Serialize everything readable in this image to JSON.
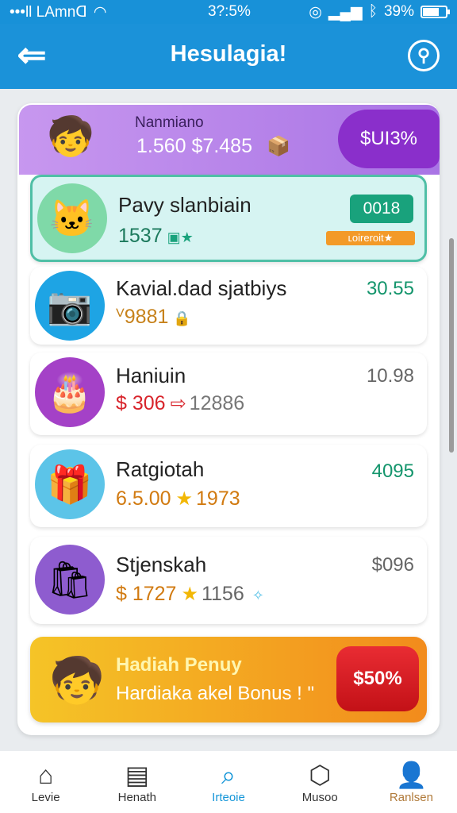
{
  "status_bar": {
    "carrier": "•••ll LAmnᗡ",
    "time": "3?:5%",
    "battery": "39%"
  },
  "header": {
    "title": "Hesulagia!",
    "back_icon": "back-arrow-icon",
    "settings_icon": "settings-icon"
  },
  "summary": {
    "name": "Nanmiano",
    "amount": "1.560 $7.485",
    "badge": "$UI3%"
  },
  "items": [
    {
      "name": "Pavy slanbiain",
      "price": "1537",
      "value": "0018",
      "badge_sub": "ʟoireroit★",
      "price_color": "#1c7a5d",
      "value_color": "#0f8f6a"
    },
    {
      "name": "Kavial.dad sjatbiys",
      "price": "ⱽ9881",
      "value": "30.55",
      "price_color": "#c7821b",
      "value_color": "#14956c"
    },
    {
      "name": "Haniuin",
      "price": "$ 306",
      "extra": "12886",
      "value": "10.98",
      "price_color": "#d8242b",
      "value_color": "#666666"
    },
    {
      "name": "Ratgiotah",
      "price": "6.5.00",
      "extra": "1973",
      "value": "4095",
      "price_color": "#d17a10",
      "value_color": "#14956c"
    },
    {
      "name": "Stjenskah",
      "price": "$ 1727",
      "extra": "1156",
      "value": "$096",
      "price_color": "#d17a10",
      "value_color": "#666666"
    }
  ],
  "bonus": {
    "title": "Hadiah Penuy",
    "subtitle": "Hardiaka akel Bonus ! \"",
    "badge": "$50%"
  },
  "nav": [
    {
      "label": "Levie",
      "icon": "home-icon"
    },
    {
      "label": "Henath",
      "icon": "gift-box-icon"
    },
    {
      "label": "Irteoie",
      "icon": "search-icon"
    },
    {
      "label": "Musoo",
      "icon": "hexagon-badge-icon"
    },
    {
      "label": "Ranlsen",
      "icon": "profile-icon"
    }
  ],
  "colors": {
    "header_blue": "#1b92d9",
    "summary_purple": "#a974e5",
    "accent_green": "#19a27c",
    "bonus_orange": "#f28b1c",
    "bonus_red": "#e92c33"
  }
}
